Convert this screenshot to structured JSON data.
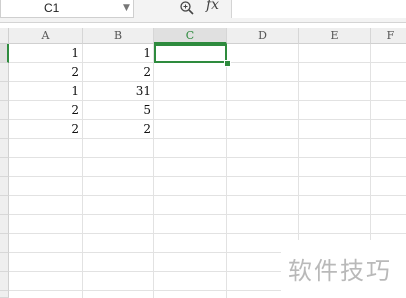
{
  "formula_bar": {
    "name_box_value": "C1",
    "zoom_icon": "magnifier-zoom-icon",
    "function_label": "fx",
    "formula_value": ""
  },
  "grid": {
    "columns": [
      "A",
      "B",
      "C",
      "D",
      "E",
      "F"
    ],
    "active_column": "C",
    "active_cell": "C1",
    "rows": [
      {
        "A": "1",
        "B": "1"
      },
      {
        "A": "2",
        "B": "2"
      },
      {
        "A": "1",
        "B": "31"
      },
      {
        "A": "2",
        "B": "5"
      },
      {
        "A": "2",
        "B": "2"
      }
    ]
  },
  "watermark": {
    "text": "软件技巧"
  },
  "colors": {
    "accent": "#2e8b3e",
    "header_bg": "#efefef",
    "gridline": "#e2e2e2"
  }
}
